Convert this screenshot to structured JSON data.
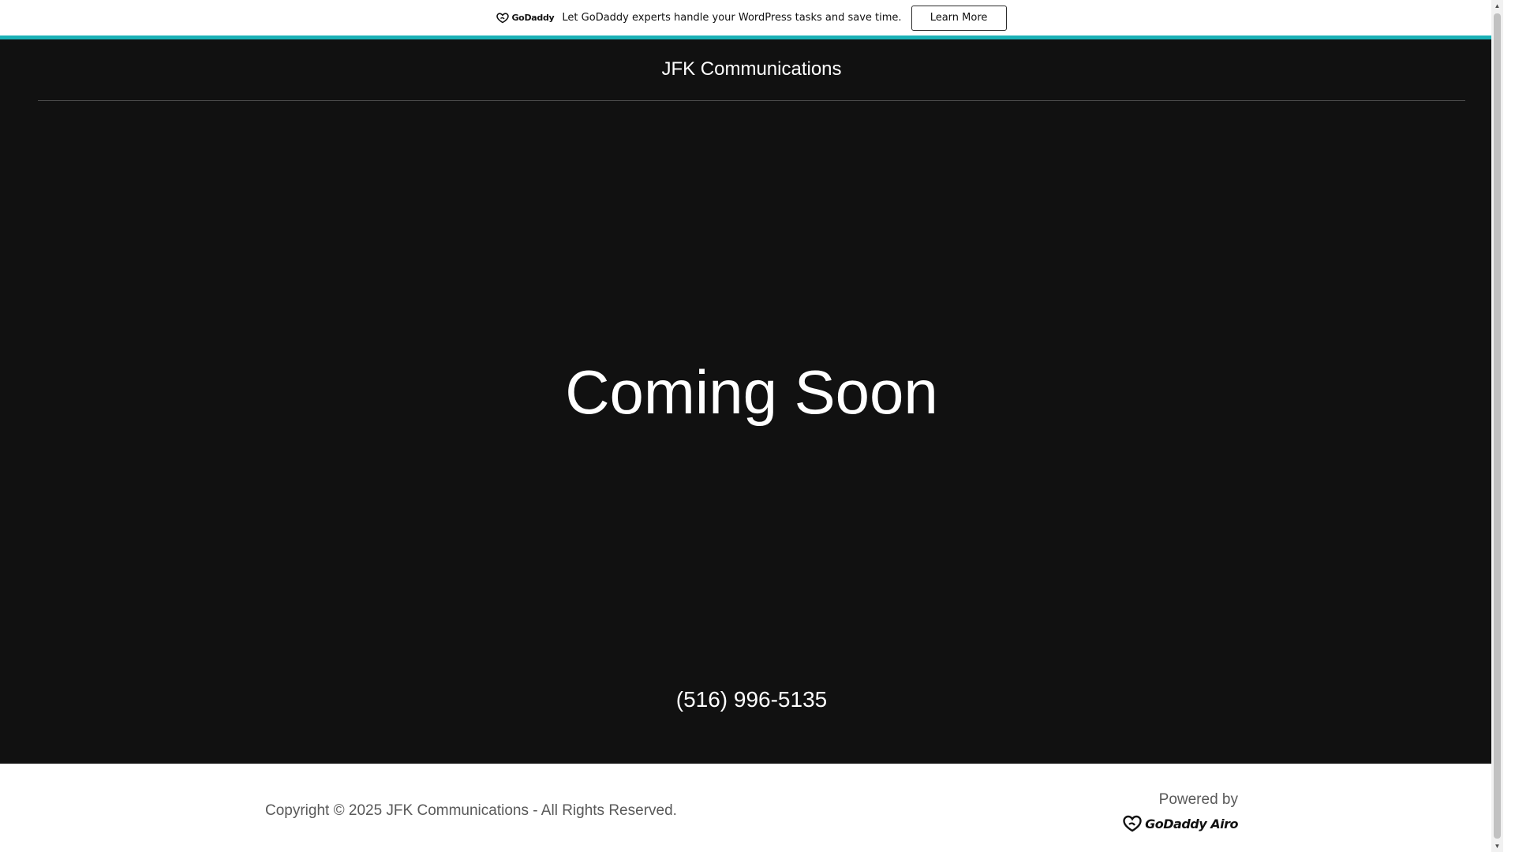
{
  "promo_bar": {
    "logo_text": "GoDaddy",
    "message": "Let GoDaddy experts handle your WordPress tasks and save time.",
    "button_label": "Learn More",
    "accent_color": "#1bb1b6"
  },
  "header": {
    "site_title": "JFK Communications"
  },
  "hero": {
    "heading": "Coming Soon",
    "phone": "(516) 996-5135",
    "background_color": "#111111"
  },
  "footer": {
    "copyright": "Copyright © 2025 JFK Communications - All Rights Reserved.",
    "powered_by_label": "Powered by",
    "logo_text": "GoDaddy Airo"
  },
  "icons": {
    "promo_logo": "godaddy-logo-icon",
    "footer_logo": "godaddy-airo-logo-icon"
  }
}
